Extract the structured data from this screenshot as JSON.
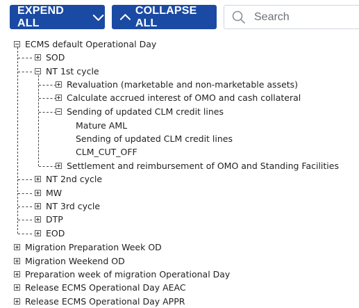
{
  "toolbar": {
    "expand_label": "EXPEND ALL",
    "collapse_label": "COLLAPSE ALL",
    "search_placeholder": "Search"
  },
  "colors": {
    "button_bg": "#1a4aa3",
    "button_text": "#ffffff",
    "search_border": "#cfd6de"
  },
  "tree": {
    "root": {
      "label": "ECMS default Operational Day",
      "state": "expanded"
    },
    "level1": [
      {
        "label": "SOD",
        "state": "collapsed"
      },
      {
        "label": "NT 1st cycle",
        "state": "expanded"
      },
      {
        "label": "NT 2nd cycle",
        "state": "collapsed"
      },
      {
        "label": "MW",
        "state": "collapsed"
      },
      {
        "label": "NT 3rd cycle",
        "state": "collapsed"
      },
      {
        "label": "DTP",
        "state": "collapsed"
      },
      {
        "label": "EOD",
        "state": "collapsed"
      }
    ],
    "nt1_children": [
      {
        "label": "Revaluation (marketable and non-marketable assets)",
        "state": "collapsed"
      },
      {
        "label": "Calculate accrued interest of OMO and cash collateral",
        "state": "collapsed"
      },
      {
        "label": "Sending of updated CLM credit lines",
        "state": "expanded"
      },
      {
        "label": "Settlement and reimbursement of OMO and Standing Facilities",
        "state": "collapsed"
      }
    ],
    "clm_leaves": [
      {
        "label": "Mature AML"
      },
      {
        "label": "Sending of updated CLM credit lines"
      },
      {
        "label": "CLM_CUT_OFF"
      }
    ],
    "top_level": [
      {
        "label": "Migration Preparation Week OD",
        "state": "collapsed"
      },
      {
        "label": "Migration Weekend OD",
        "state": "collapsed"
      },
      {
        "label": "Preparation week of migration Operational Day",
        "state": "collapsed"
      },
      {
        "label": "Release ECMS Operational Day AEAC",
        "state": "collapsed"
      },
      {
        "label": "Release ECMS Operational Day APPR",
        "state": "collapsed"
      }
    ]
  }
}
